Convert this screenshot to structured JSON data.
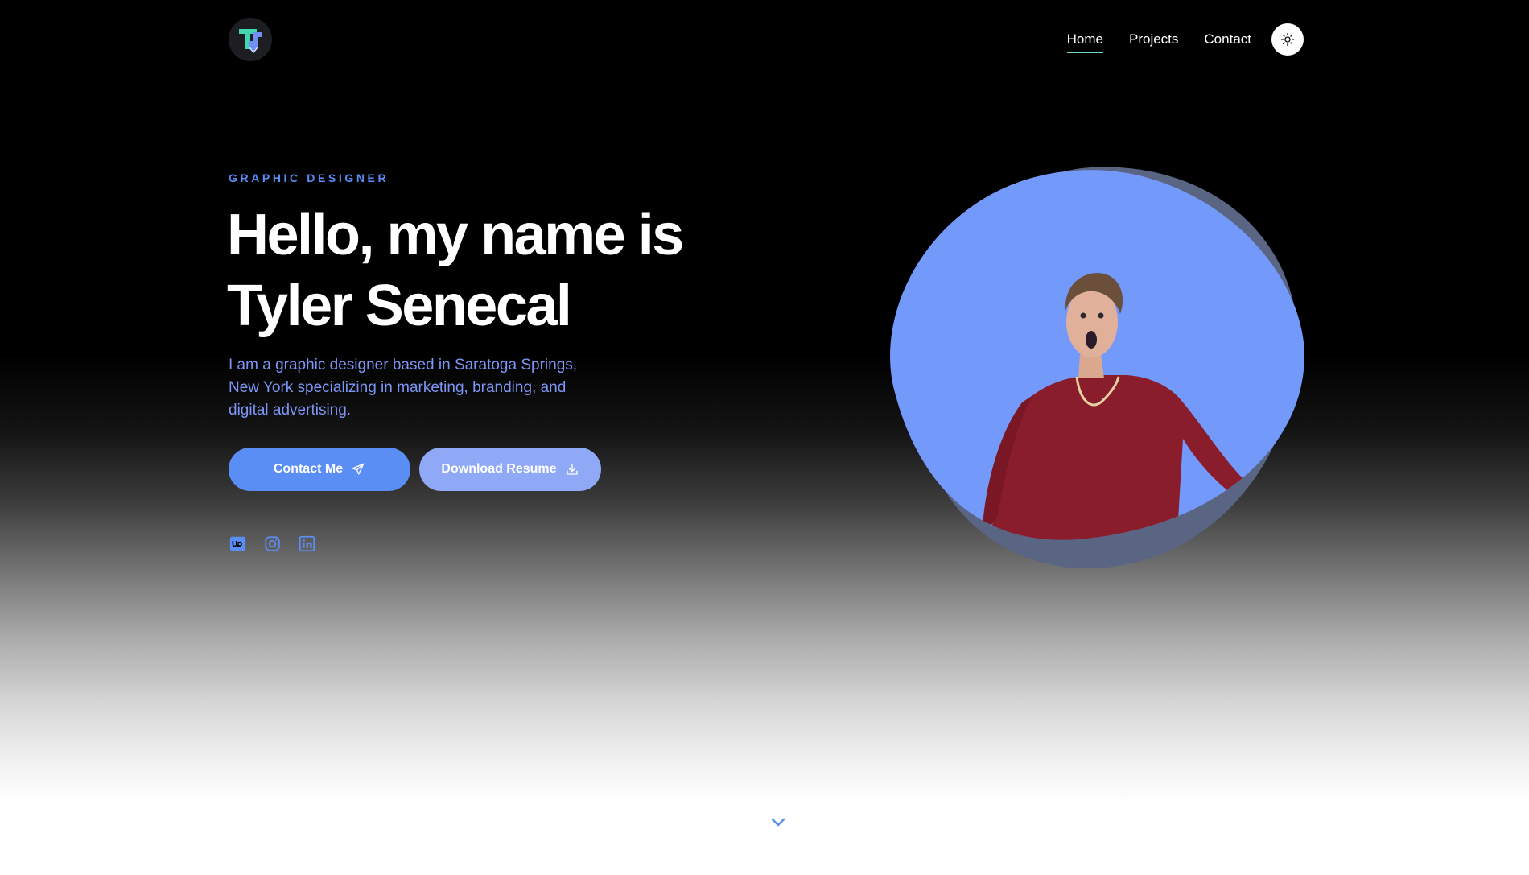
{
  "header": {
    "logo_text": "TS",
    "nav": [
      {
        "label": "Home",
        "active": true
      },
      {
        "label": "Projects",
        "active": false
      },
      {
        "label": "Contact",
        "active": false
      }
    ],
    "theme_toggle_icon": "sun-icon"
  },
  "hero": {
    "eyebrow": "GRAPHIC DESIGNER",
    "headline_line1": "Hello, my name is",
    "headline_line2": "Tyler Senecal",
    "intro": "I am a graphic designer based in Saratoga Springs, New York specializing in marketing, branding, and digital advertising.",
    "buttons": {
      "contact_label": "Contact Me",
      "contact_icon": "send-icon",
      "resume_label": "Download Resume",
      "resume_icon": "download-icon"
    },
    "socials": [
      {
        "name": "upwork-icon"
      },
      {
        "name": "instagram-icon"
      },
      {
        "name": "linkedin-icon"
      }
    ]
  },
  "scroll_indicator": {
    "icon": "chevron-down-icon"
  },
  "colors": {
    "accent": "#5b8ef5",
    "accent_light": "#8fa9f7",
    "blob": "#7399fb",
    "blob_shadow": "#5a6584",
    "nav_underline": "#6ad9c4",
    "sweater": "#8a1d2b"
  }
}
